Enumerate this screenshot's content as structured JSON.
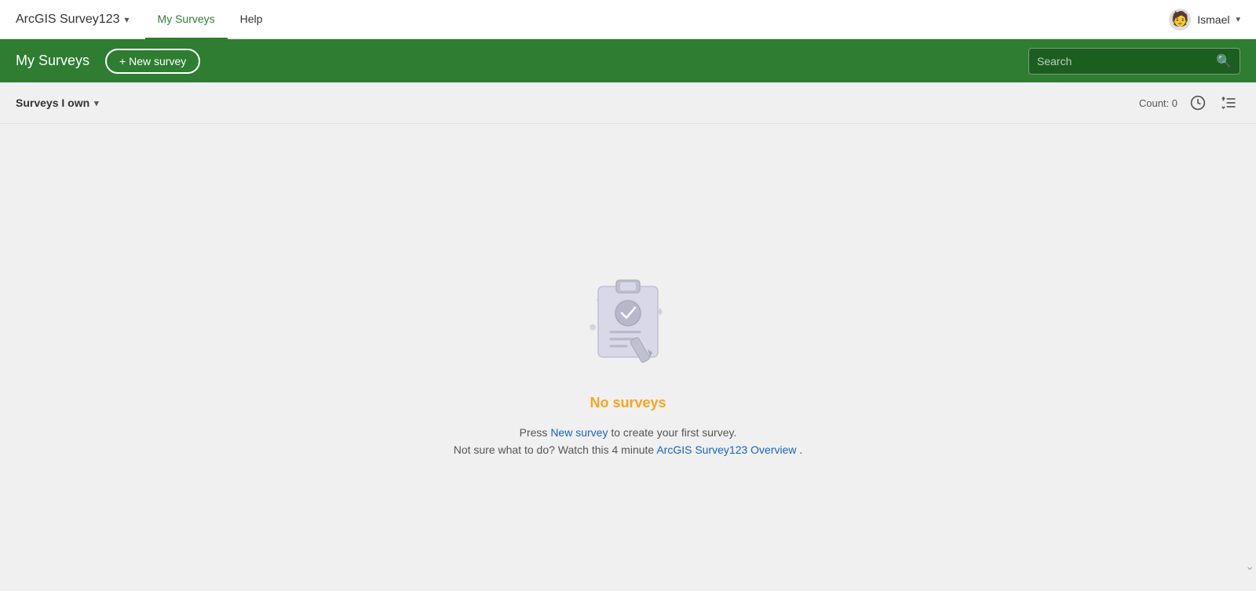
{
  "app": {
    "title": "ArcGIS Survey123",
    "title_chevron": "▾"
  },
  "nav": {
    "links": [
      {
        "id": "my-surveys",
        "label": "My Surveys",
        "active": true
      },
      {
        "id": "help",
        "label": "Help",
        "active": false
      }
    ]
  },
  "user": {
    "name": "Ismael",
    "avatar_emoji": "🧑",
    "chevron": "▾"
  },
  "green_bar": {
    "title": "My Surveys",
    "new_survey_label": "+ New survey",
    "search_placeholder": "Search"
  },
  "toolbar": {
    "filter_label": "Surveys I own",
    "filter_chevron": "▾",
    "count_label": "Count: 0"
  },
  "empty_state": {
    "title": "No surveys",
    "description_prefix": "Press ",
    "new_survey_link": "New survey",
    "description_mid": " to create your first survey.",
    "description_line2_prefix": "Not sure what to do? Watch this 4 minute ",
    "overview_link": "ArcGIS Survey123 Overview",
    "description_line2_suffix": " ."
  },
  "icons": {
    "clock": "⏱",
    "sort": "↑↓"
  }
}
